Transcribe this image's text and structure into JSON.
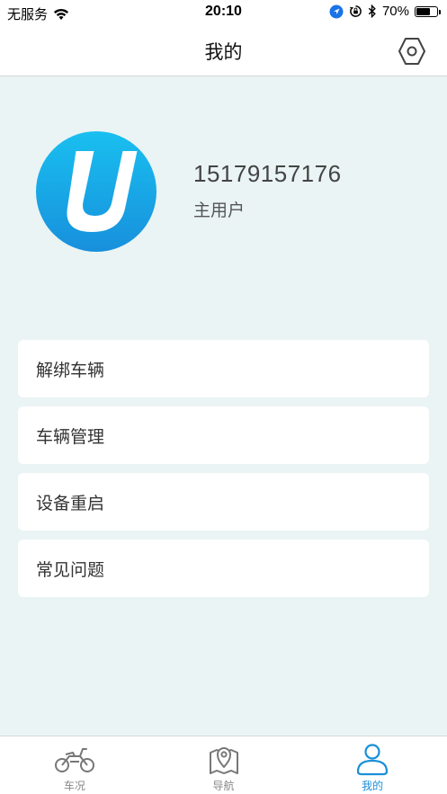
{
  "status_bar": {
    "carrier": "无服务",
    "time": "20:10",
    "battery_percent": "70%",
    "battery_level": 0.7
  },
  "header": {
    "title": "我的",
    "settings_icon": "settings-hexagon-icon"
  },
  "profile": {
    "avatar_letter": "U",
    "phone": "15179157176",
    "role": "主用户"
  },
  "menu": {
    "items": [
      {
        "label": "解绑车辆"
      },
      {
        "label": "车辆管理"
      },
      {
        "label": "设备重启"
      },
      {
        "label": "常见问题"
      }
    ]
  },
  "tabbar": {
    "tabs": [
      {
        "label": "车况",
        "icon": "motorcycle-icon"
      },
      {
        "label": "导航",
        "icon": "map-pin-icon"
      },
      {
        "label": "我的",
        "icon": "user-icon"
      }
    ],
    "active": "我的"
  },
  "colors": {
    "accent": "#1a8fd8",
    "background": "#eaf4f4"
  }
}
